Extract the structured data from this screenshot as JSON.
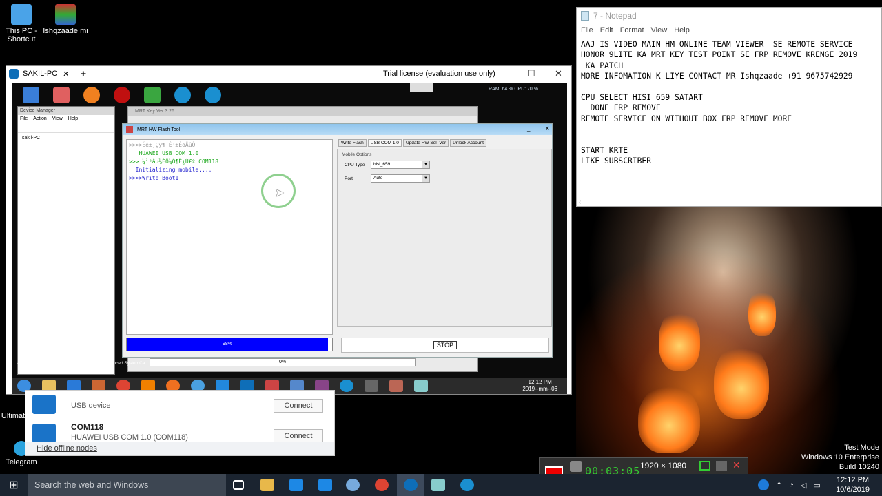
{
  "desktop": {
    "icons": [
      {
        "label": "This PC - Shortcut"
      },
      {
        "label": "Ishqzaade mi"
      },
      {
        "label": "Ultimat"
      },
      {
        "label": "Telegram"
      }
    ]
  },
  "notepad": {
    "title": "7 - Notepad",
    "menu": [
      "File",
      "Edit",
      "Format",
      "View",
      "Help"
    ],
    "content": "AAJ IS VIDEO MAIN HM ONLINE TEAM VIEWER  SE REMOTE SERVICE\nHONOR 9LITE KA MRT KEY TEST POINT SE FRP REMOVE KRENGE 2019\n KA PATCH\nMORE INFOMATION K LIYE CONTACT MR Ishqzaade +91 9675742929\n\nCPU SELECT HISI 659 SATART\n  DONE FRP REMOVE\nREMOTE SERVICE ON WITHOUT BOX FRP REMOVE MORE\n\n\nSTART KRTE\nLIKE SUBSCRIBER"
  },
  "teamviewer": {
    "tab_label": "SAKIL-PC",
    "license": "Trial license (evaluation use only)",
    "remote": {
      "stats": "RAM: 64 %  CPU: 70 %",
      "device_manager": {
        "title": "Device Manager",
        "menu": [
          "File",
          "Action",
          "View",
          "Help"
        ],
        "node": "sakil-PC"
      },
      "mrt_key_title": "MRT Key Ver 3.26",
      "flash_tool": {
        "title": "MRT HW Flash Tool",
        "log": [
          {
            "text": ">>>>Éê±¸Çý¶¯Ê¹±ÈõÄûÔ",
            "color": "#999999"
          },
          {
            "text": "   HUAWEI USB COM 1.0",
            "color": "#22aa22"
          },
          {
            "text": ">>> ¼ì²âµ½ÉÕ¼Ó¶Ë¿Ú£º COM118",
            "color": "#22aa22"
          },
          {
            "text": "  Initializing mobile....",
            "color": "#2a2ad0"
          },
          {
            "text": ">>>>Write Boot1",
            "color": "#2a2ad0"
          }
        ],
        "tabs": [
          "Write Flash",
          "USB COM 1.0",
          "Update HW Sol_Ver",
          "Unlock Account"
        ],
        "options_group": "Mobile Options",
        "cpu_type_label": "CPU Type",
        "cpu_type_value": "hisi_659",
        "port_label": "Port",
        "port_value": "Auto",
        "progress_percent": 98,
        "progress_label": "98%",
        "stop_label": "STOP"
      },
      "lower_progress_label": "0%",
      "bottom_icons": [
        "ASUS Flash Tool",
        "VLC media player",
        "Advanced SystemCa..."
      ],
      "clock_time": "12:12 PM",
      "clock_date": "2019--mm--06"
    }
  },
  "partners": {
    "rows": [
      {
        "name": "",
        "desc": "USB device",
        "button": "Connect"
      },
      {
        "name": "COM118",
        "desc": "HUAWEI USB COM 1.0 (COM118)",
        "button": "Connect"
      }
    ],
    "hide_offline": "Hide offline nodes"
  },
  "recorder": {
    "time": "00:03:05",
    "resolution": "1920 × 1080"
  },
  "watermark": {
    "line1": "Test Mode",
    "line2": "Windows 10 Enterprise",
    "line3": "Build 10240"
  },
  "taskbar": {
    "search_placeholder": "Search the web and Windows",
    "time": "12:12 PM",
    "date": "10/6/2019"
  },
  "colors": {
    "taskbar": "#1b2430",
    "progress_fill": "#0000ff",
    "record": "#ee0000"
  }
}
